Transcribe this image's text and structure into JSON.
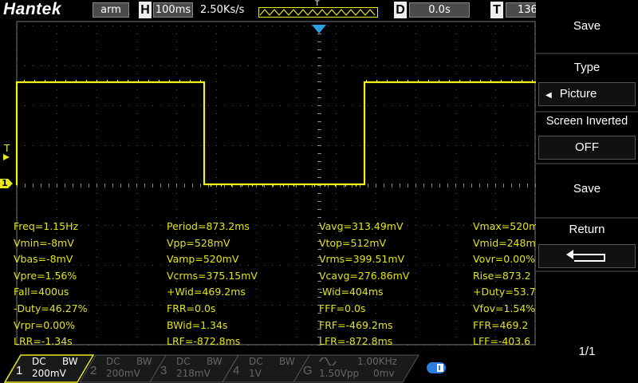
{
  "topbar": {
    "brand": "Hantek",
    "mode": "arm",
    "timebase_letter": "H",
    "timebase": "100ms",
    "sample_rate": "2.50Ks/s",
    "trigger_marker": "T",
    "delay_letter": "D",
    "delay": "0.0s",
    "trigger_letter": "T",
    "trigger_value": "136"
  },
  "screen": {
    "trigger_level_marker": "T",
    "channel_marker": "1"
  },
  "measurements": [
    [
      "Freq=1.15Hz",
      "Period=873.2ms",
      "Vavg=313.49mV",
      "Vmax=520m"
    ],
    [
      "Vmin=-8mV",
      "Vpp=528mV",
      "Vtop=512mV",
      "Vmid=248m"
    ],
    [
      "Vbas=-8mV",
      "Vamp=520mV",
      "Vrms=399.51mV",
      "Vovr=0.00%"
    ],
    [
      "Vpre=1.56%",
      "Vcrms=375.15mV",
      "Vcavg=276.86mV",
      "Rise=873.2"
    ],
    [
      "Fall=400us",
      "+Wid=469.2ms",
      "-Wid=404ms",
      "+Duty=53.7"
    ],
    [
      "-Duty=46.27%",
      "FRR=0.0s",
      "FFF=0.0s",
      "Vfov=1.54%"
    ],
    [
      "Vrpr=0.00%",
      "BWid=1.34s",
      "FRF=-469.2ms",
      "FFR=469.2"
    ],
    [
      "LRR=-1.34s",
      "LRF=-872.8ms",
      "LFR=-872.8ms",
      "LFF=-403.6"
    ]
  ],
  "channels": [
    {
      "num": "1",
      "coupling": "DC",
      "bw": "BW",
      "scale": "200mV",
      "color": "#e8e81a",
      "active": true
    },
    {
      "num": "2",
      "coupling": "DC",
      "bw": "BW",
      "scale": "200mV",
      "color": "#666666",
      "active": false
    },
    {
      "num": "3",
      "coupling": "DC",
      "bw": "BW",
      "scale": "218mV",
      "color": "#666666",
      "active": false
    },
    {
      "num": "4",
      "coupling": "DC",
      "bw": "BW",
      "scale": "1V",
      "color": "#666666",
      "active": false
    }
  ],
  "generator": {
    "letter": "G",
    "wave_icon": "sine-wave-icon",
    "freq": "1.00KHz",
    "amp": "1.50Vpp",
    "offset": "0mv"
  },
  "status_icon": "usb-icon",
  "menu": {
    "title": "Save",
    "type_label": "Type",
    "type_value": "Picture",
    "inverted_label": "Screen Inverted",
    "inverted_value": "OFF",
    "save_label": "Save",
    "return_label": "Return",
    "page": "1/1"
  },
  "colors": {
    "trace": "#f2f21b",
    "grid": "#5a5a5a",
    "trigger_marker": "#2a9ee8",
    "measurement_text": "#e4e416"
  }
}
